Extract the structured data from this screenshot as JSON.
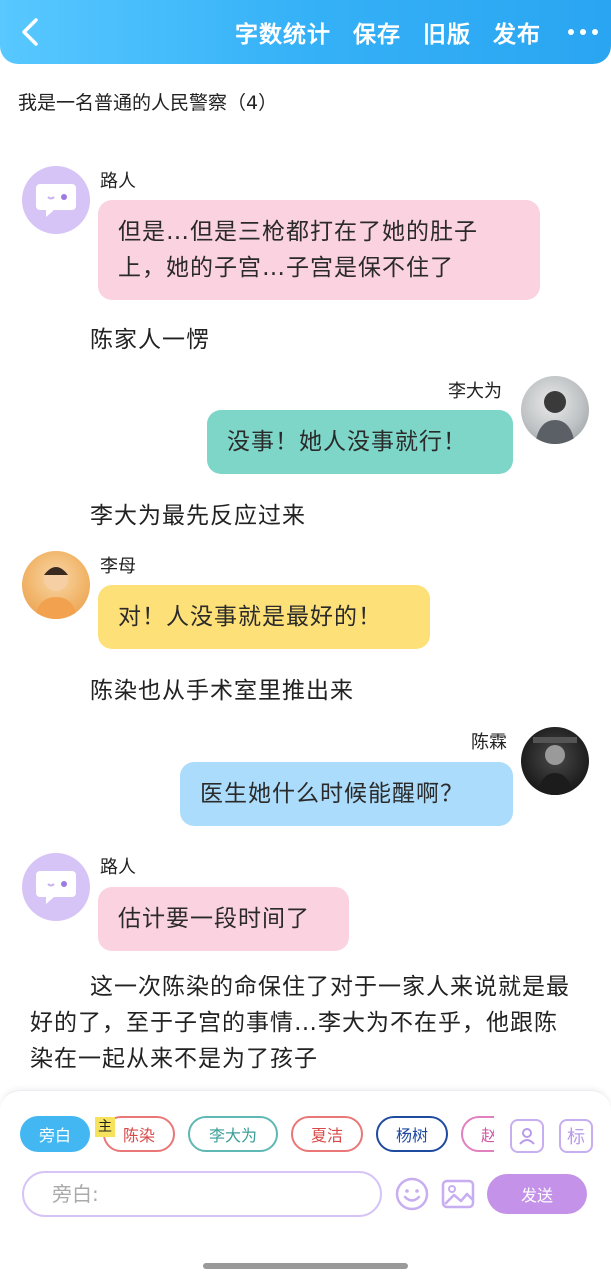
{
  "header": {
    "actions": [
      "字数统计",
      "保存",
      "旧版",
      "发布"
    ]
  },
  "doc_title": "我是一名普通的人民警察（4）",
  "messages": [
    {
      "name": "路人",
      "text": "但是…但是三枪都打在了她的肚子上，她的子宫…子宫是保不住了"
    },
    {
      "narration": "陈家人一愣"
    },
    {
      "name": "李大为",
      "text": "没事！她人没事就行！"
    },
    {
      "narration": "李大为最先反应过来"
    },
    {
      "name": "李母",
      "text": "对！人没事就是最好的！"
    },
    {
      "narration": "陈染也从手术室里推出来"
    },
    {
      "name": "陈霖",
      "text": "医生她什么时候能醒啊？"
    },
    {
      "name": "路人",
      "text": "估计要一段时间了"
    },
    {
      "narration": "这一次陈染的命保住了对于一家人来说就是最好的了，至于子宫的事情…李大为不在乎，他跟陈染在一起从来不是为了孩子"
    }
  ],
  "bottom": {
    "chips": [
      "旁白",
      "陈染",
      "李大为",
      "夏洁",
      "杨树",
      "赵"
    ],
    "main_badge": "主",
    "tool_label": "标",
    "input_placeholder": "旁白:",
    "send_label": "发送"
  },
  "colors": {
    "header": "#35b1f7",
    "pink_bubble": "#fbd2df",
    "teal_bubble": "#7dd6c8",
    "yellow_bubble": "#fde077",
    "blue_bubble": "#acdcfb",
    "purple_accent": "#c492e8"
  }
}
